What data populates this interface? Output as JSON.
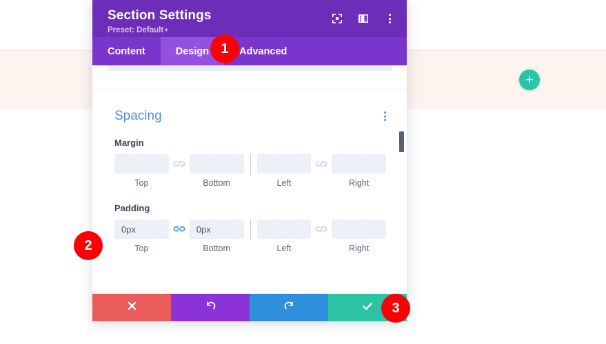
{
  "page": {
    "background_color": "#ffffff",
    "band_color": "#fdf4ef"
  },
  "canvas": {
    "add_section_button": {
      "icon": "plus-icon",
      "label": "+",
      "color": "#2ac4a8"
    }
  },
  "modal": {
    "title": "Section Settings",
    "preset_label": "Preset: Default",
    "preset_caret": "▾",
    "header_color": "#6c2eb9",
    "header_tools": [
      {
        "name": "focus-target-icon"
      },
      {
        "name": "layout-panel-icon"
      },
      {
        "name": "more-options-icon"
      }
    ],
    "tabs": [
      {
        "label": "Content",
        "active": false
      },
      {
        "label": "Design",
        "active": true
      },
      {
        "label": "Advanced",
        "active": false
      }
    ],
    "tab_bar_color": "#7a35cc",
    "active_tab_color": "#9450e0",
    "search_placeholder": "",
    "sections": [
      {
        "heading": "Spacing",
        "heading_color": "#4a90e2",
        "groups": [
          {
            "label": "Margin",
            "link_state_vertical": "unlinked",
            "link_state_horizontal": "unlinked",
            "fields": [
              {
                "caption": "Top",
                "value": "",
                "placeholder": ""
              },
              {
                "caption": "Bottom",
                "value": "",
                "placeholder": ""
              },
              {
                "caption": "Left",
                "value": "",
                "placeholder": ""
              },
              {
                "caption": "Right",
                "value": "",
                "placeholder": ""
              }
            ]
          },
          {
            "label": "Padding",
            "link_state_vertical": "linked",
            "link_state_horizontal": "unlinked",
            "fields": [
              {
                "caption": "Top",
                "value": "0px",
                "placeholder": ""
              },
              {
                "caption": "Bottom",
                "value": "0px",
                "placeholder": ""
              },
              {
                "caption": "Left",
                "value": "",
                "placeholder": ""
              },
              {
                "caption": "Right",
                "value": "",
                "placeholder": ""
              }
            ]
          }
        ]
      }
    ],
    "footer_buttons": [
      {
        "name": "cancel",
        "icon": "close-x-icon",
        "color": "#eb5d5b"
      },
      {
        "name": "undo",
        "icon": "undo-arrow-icon",
        "color": "#8b33d6"
      },
      {
        "name": "redo",
        "icon": "redo-arrow-icon",
        "color": "#2f8fdd"
      },
      {
        "name": "save",
        "icon": "checkmark-icon",
        "color": "#2cc3a5"
      }
    ]
  },
  "callouts": [
    {
      "number": "1",
      "color": "#fb0007"
    },
    {
      "number": "2",
      "color": "#fb0007"
    },
    {
      "number": "3",
      "color": "#fb0007"
    }
  ]
}
